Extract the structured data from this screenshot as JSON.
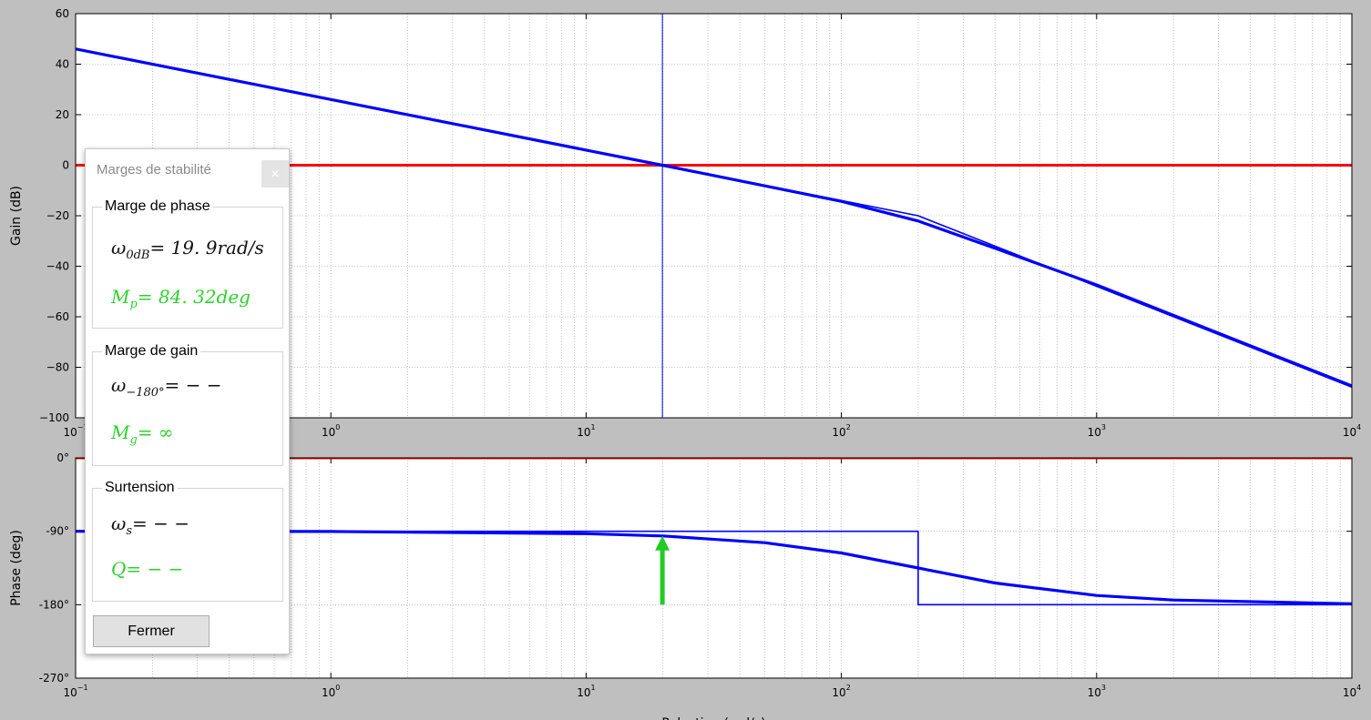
{
  "chart_data": [
    {
      "type": "line",
      "xscale": "log",
      "xlim": [
        0.1,
        10000
      ],
      "ylim": [
        -100,
        60
      ],
      "ylabel": "Gain (dB)",
      "yticks": [
        "60",
        "40",
        "20",
        "0",
        "−20",
        "−40",
        "−60",
        "−80",
        "−100"
      ],
      "xticks": [
        {
          "base": "10",
          "exp": "−1"
        },
        {
          "base": "10",
          "exp": "0"
        },
        {
          "base": "10",
          "exp": "1"
        },
        {
          "base": "10",
          "exp": "2"
        },
        {
          "base": "10",
          "exp": "3"
        },
        {
          "base": "10",
          "exp": "4"
        }
      ],
      "grid": true,
      "series": [
        {
          "color": "#0000ff",
          "style": "exact",
          "x": [
            0.1,
            1,
            10,
            19.9,
            100,
            200,
            400,
            1000,
            10000
          ],
          "y": [
            46,
            26,
            6,
            0,
            -14.3,
            -22.1,
            -32.9,
            -47.4,
            -87.4
          ]
        },
        {
          "color": "#0000ff",
          "style": "asymptotic",
          "x": [
            0.1,
            200,
            10000
          ],
          "y": [
            46,
            -20,
            -87.9
          ]
        }
      ],
      "reference_line_y": {
        "value": 0,
        "color": "#ff0000"
      },
      "marker_x": {
        "value": 19.9,
        "color": "#0000ff"
      }
    },
    {
      "type": "line",
      "xscale": "log",
      "xlim": [
        0.1,
        10000
      ],
      "ylim": [
        -270,
        0
      ],
      "ylabel": "Phase (deg)",
      "xlabel": "Pulsation (rad/s)",
      "yticks": [
        "0°",
        "-90°",
        "-180°",
        "-270°"
      ],
      "xticks": [
        {
          "base": "10",
          "exp": "−1"
        },
        {
          "base": "10",
          "exp": "0"
        },
        {
          "base": "10",
          "exp": "1"
        },
        {
          "base": "10",
          "exp": "2"
        },
        {
          "base": "10",
          "exp": "3"
        },
        {
          "base": "10",
          "exp": "4"
        }
      ],
      "grid": true,
      "series": [
        {
          "color": "#0000ff",
          "style": "exact",
          "x": [
            0.1,
            1,
            10,
            20,
            50,
            100,
            200,
            400,
            1000,
            2000,
            10000
          ],
          "y": [
            -90,
            -90.3,
            -92.9,
            -95.7,
            -104,
            -116.6,
            -135,
            -153.4,
            -168.7,
            -174.3,
            -178.9
          ]
        },
        {
          "color": "#0000ff",
          "style": "asymptotic",
          "x": [
            0.1,
            200,
            200,
            10000
          ],
          "y": [
            -90,
            -90,
            -180,
            -180
          ]
        }
      ],
      "reference_line_y": {
        "value": 0,
        "color": "#ff0000"
      },
      "arrow": {
        "x": 19.9,
        "from": -180,
        "to": -95.7,
        "color": "#22cc22"
      }
    }
  ],
  "dialog": {
    "title": "Marges de stabilité",
    "close_glyph": "×",
    "phase_group": {
      "label": "Marge de phase",
      "omega_sub": "0dB",
      "omega_value": "= 19. 9rad/s",
      "mp_sub": "p",
      "mp_value": "= 84. 32deg"
    },
    "gain_group": {
      "label": "Marge de gain",
      "omega_sub": "−180°",
      "omega_value": "= − −",
      "mg_sub": "g",
      "mg_value": "= ∞"
    },
    "surtension_group": {
      "label": "Surtension",
      "omega_sub": "s",
      "omega_value": "= − −",
      "q_value": "= − −"
    },
    "close_button": "Fermer"
  }
}
